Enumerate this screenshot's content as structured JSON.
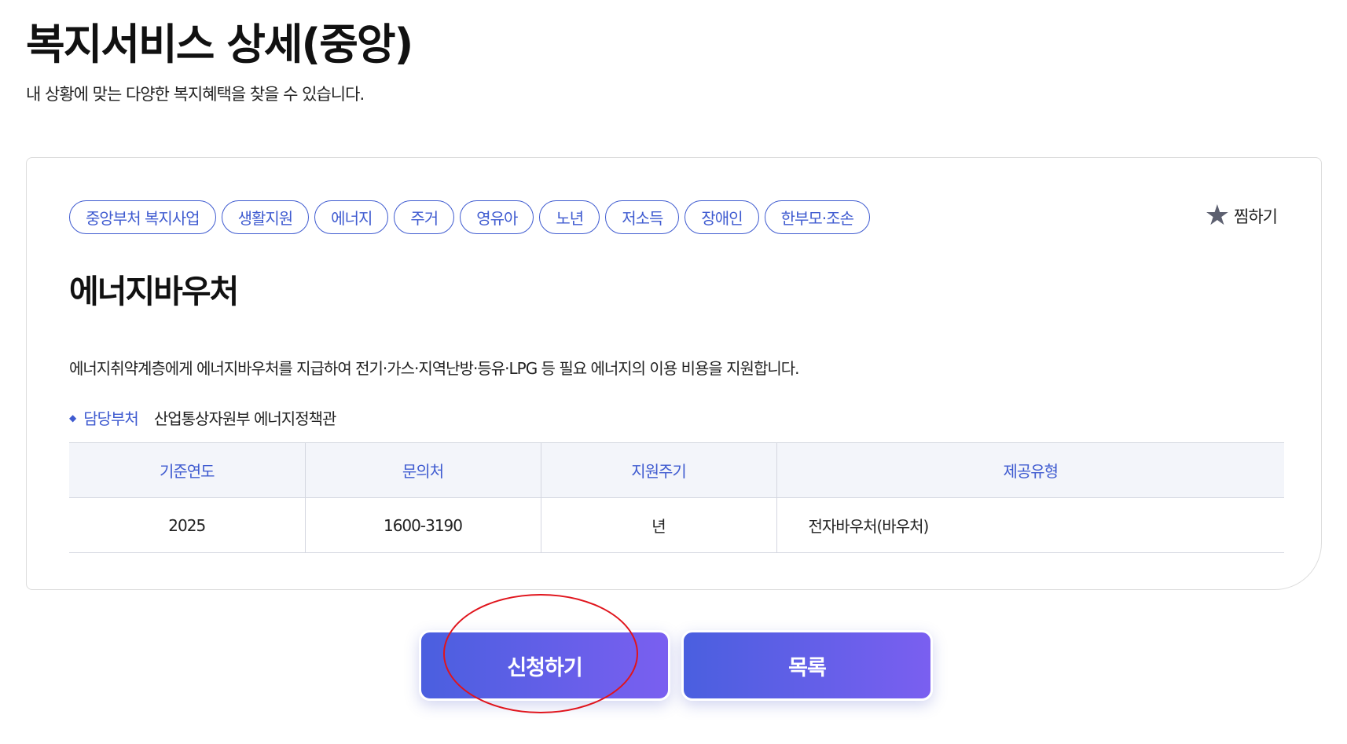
{
  "header": {
    "title": "복지서비스 상세(중앙)",
    "subtitle": "내 상황에 맞는 다양한 복지혜택을 찾을 수 있습니다."
  },
  "service": {
    "tags": [
      "중앙부처 복지사업",
      "생활지원",
      "에너지",
      "주거",
      "영유아",
      "노년",
      "저소득",
      "장애인",
      "한부모·조손"
    ],
    "bookmark_label": "찜하기",
    "bookmark_icon": "star-icon",
    "title": "에너지바우처",
    "description": "에너지취약계층에게 에너지바우처를 지급하여 전기·가스·지역난방·등유·LPG 등 필요 에너지의 이용 비용을 지원합니다.",
    "department_label": "담당부처",
    "department_value": "산업통상자원부 에너지정책관"
  },
  "info_table": {
    "headers": [
      "기준연도",
      "문의처",
      "지원주기",
      "제공유형"
    ],
    "row": [
      "2025",
      "1600-3190",
      "년",
      "전자바우처(바우처)"
    ]
  },
  "actions": {
    "apply_label": "신청하기",
    "list_label": "목록"
  },
  "colors": {
    "accent": "#3f5bd0",
    "button_gradient_start": "#4a5fdf",
    "button_gradient_end": "#7a5ff0",
    "annotation": "#e0141c"
  }
}
